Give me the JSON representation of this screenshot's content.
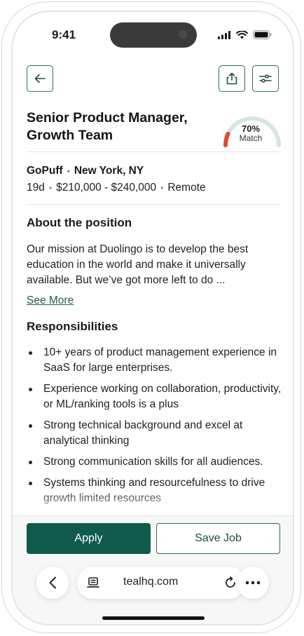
{
  "status_bar": {
    "time": "9:41"
  },
  "header": {
    "back_icon": "arrow-left-icon",
    "share_icon": "share-icon",
    "filter_icon": "sliders-icon"
  },
  "job": {
    "title": "Senior Product Manager, Growth Team",
    "match_percent": "70%",
    "match_value": 70,
    "match_label": "Match",
    "company": "GoPuff",
    "location": "New York, NY",
    "posted": "19d",
    "salary": "$210,000 - $240,000",
    "work_type": "Remote"
  },
  "about": {
    "heading": "About the position",
    "text": "Our mission at Duolingo is to develop the best education in the world and make it universally available. But we’ve got more left to do ...",
    "see_more": "See More"
  },
  "responsibilities": {
    "heading": "Responsibilities",
    "items": [
      "10+ years of product management experience in SaaS for large enterprises.",
      "Experience working on collaboration, productivity, or ML/ranking tools is a plus",
      "Strong technical background and excel at analytical thinking",
      "Strong communication skills for all audiences.",
      "Systems thinking and resourcefulness to drive growth limited resources"
    ]
  },
  "actions": {
    "apply_label": "Apply",
    "save_label": "Save Job"
  },
  "browser": {
    "url": "tealhq.com"
  },
  "colors": {
    "accent": "#0f5a4c",
    "gauge_fill": "#e24b2a",
    "gauge_track": "#d5e5df"
  }
}
